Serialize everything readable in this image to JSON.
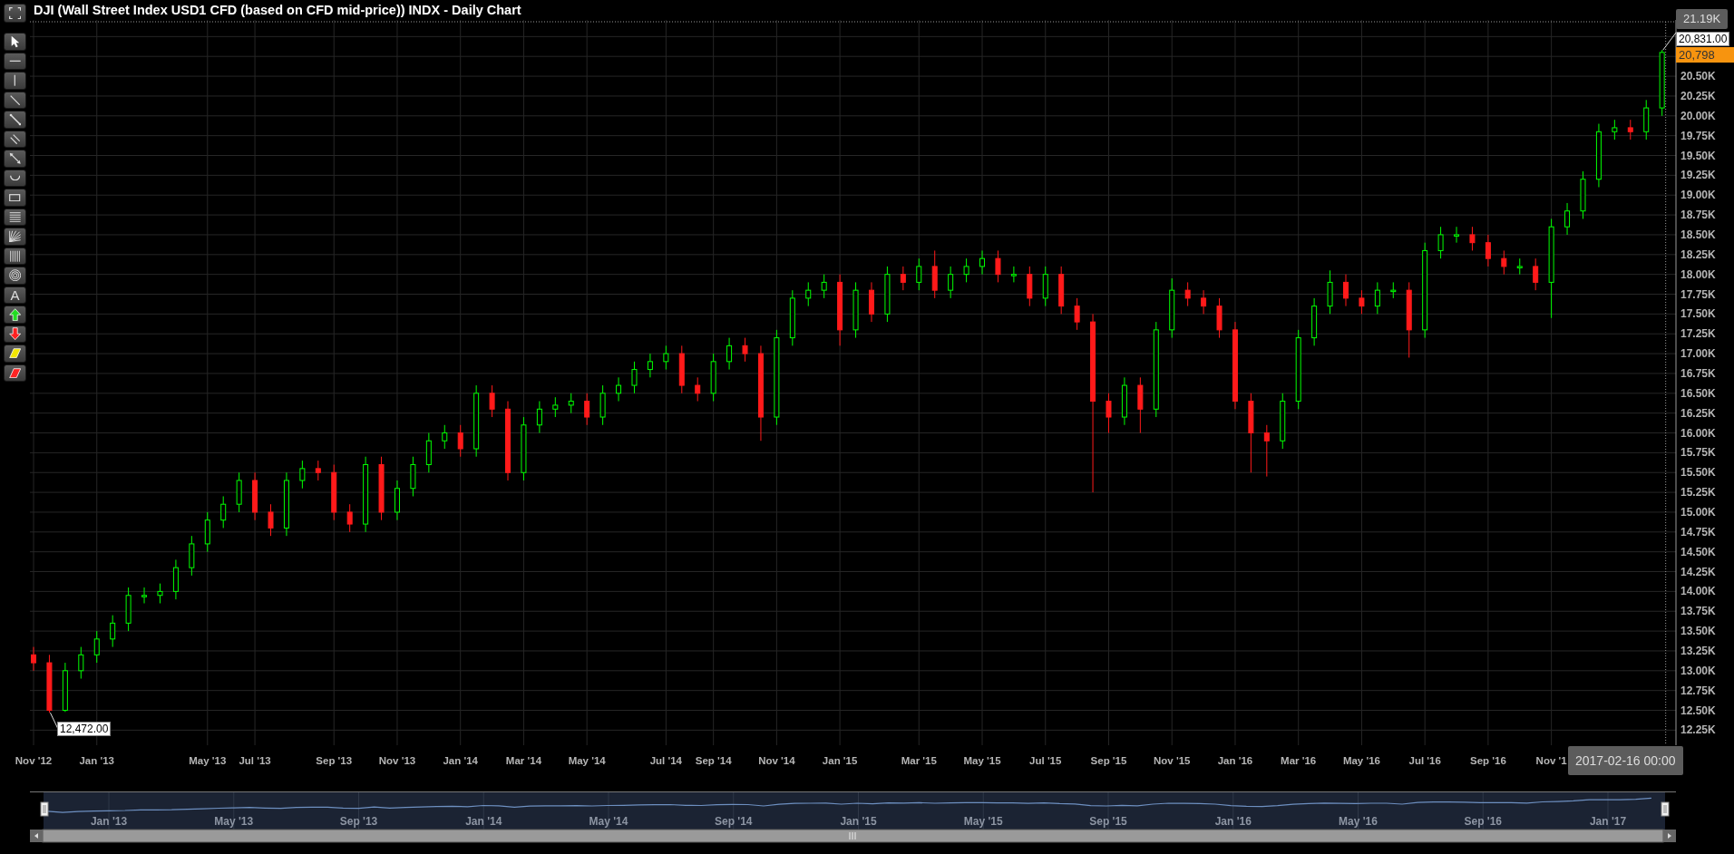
{
  "title": "DJI (Wall Street Index USD1 CFD (based on CFD mid-price)) INDX - Daily Chart",
  "toolbar": {
    "expand": {
      "kind": "expand"
    },
    "tools": [
      {
        "kind": "pointer"
      },
      {
        "kind": "hline"
      },
      {
        "kind": "vline"
      },
      {
        "kind": "trendline"
      },
      {
        "kind": "segment"
      },
      {
        "kind": "parallel"
      },
      {
        "kind": "arrowline"
      },
      {
        "kind": "arc"
      },
      {
        "kind": "rect"
      },
      {
        "kind": "levels"
      },
      {
        "kind": "fan"
      },
      {
        "kind": "cycles"
      },
      {
        "kind": "circles"
      },
      {
        "kind": "text",
        "label": "A"
      },
      {
        "kind": "up"
      },
      {
        "kind": "down"
      },
      {
        "kind": "highlighter"
      },
      {
        "kind": "eraser"
      }
    ]
  },
  "chart": {
    "chart_data": {
      "type": "candlestick",
      "categories": [
        "Nov '12",
        null,
        null,
        null,
        "Jan '13",
        null,
        null,
        null,
        null,
        null,
        null,
        "May '13",
        null,
        null,
        "Jul '13",
        null,
        null,
        null,
        null,
        "Sep '13",
        null,
        null,
        null,
        "Nov '13",
        null,
        null,
        null,
        "Jan '14",
        null,
        null,
        null,
        "Mar '14",
        null,
        null,
        null,
        "May '14",
        null,
        null,
        null,
        null,
        "Jul '14",
        null,
        null,
        "Sep '14",
        null,
        null,
        null,
        "Nov '14",
        null,
        null,
        null,
        "Jan '15",
        null,
        null,
        null,
        null,
        "Mar '15",
        null,
        null,
        null,
        "May '15",
        null,
        null,
        null,
        "Jul '15",
        null,
        null,
        null,
        "Sep '15",
        null,
        null,
        null,
        "Nov '15",
        null,
        null,
        null,
        "Jan '16",
        null,
        null,
        null,
        "Mar '16",
        null,
        null,
        null,
        "May '16",
        null,
        null,
        null,
        "Jul '16",
        null,
        null,
        null,
        "Sep '16",
        null,
        null,
        null,
        "Nov '1",
        null,
        null,
        null,
        null,
        null,
        null,
        null
      ],
      "ohlc": [
        [
          13.2,
          13.3,
          13.0,
          13.1
        ],
        [
          13.1,
          13.2,
          12.47,
          12.5
        ],
        [
          12.5,
          13.1,
          12.48,
          13.0
        ],
        [
          13.0,
          13.3,
          12.9,
          13.2
        ],
        [
          13.2,
          13.5,
          13.1,
          13.4
        ],
        [
          13.4,
          13.7,
          13.3,
          13.6
        ],
        [
          13.6,
          14.05,
          13.5,
          13.95
        ],
        [
          13.95,
          14.05,
          13.85,
          13.95
        ],
        [
          13.95,
          14.1,
          13.85,
          14.0
        ],
        [
          14.0,
          14.4,
          13.9,
          14.3
        ],
        [
          14.3,
          14.7,
          14.2,
          14.6
        ],
        [
          14.6,
          15.0,
          14.5,
          14.9
        ],
        [
          14.9,
          15.2,
          14.8,
          15.1
        ],
        [
          15.1,
          15.5,
          15.0,
          15.4
        ],
        [
          15.4,
          15.5,
          14.9,
          15.0
        ],
        [
          15.0,
          15.1,
          14.7,
          14.8
        ],
        [
          14.8,
          15.5,
          14.7,
          15.4
        ],
        [
          15.4,
          15.65,
          15.3,
          15.55
        ],
        [
          15.55,
          15.65,
          15.4,
          15.5
        ],
        [
          15.5,
          15.6,
          14.9,
          15.0
        ],
        [
          15.0,
          15.1,
          14.75,
          14.85
        ],
        [
          14.85,
          15.7,
          14.75,
          15.6
        ],
        [
          15.6,
          15.7,
          14.9,
          15.0
        ],
        [
          15.0,
          15.4,
          14.9,
          15.3
        ],
        [
          15.3,
          15.7,
          15.2,
          15.6
        ],
        [
          15.6,
          16.0,
          15.5,
          15.9
        ],
        [
          15.9,
          16.1,
          15.8,
          16.0
        ],
        [
          16.0,
          16.1,
          15.7,
          15.8
        ],
        [
          15.8,
          16.6,
          15.7,
          16.5
        ],
        [
          16.5,
          16.6,
          16.2,
          16.3
        ],
        [
          16.3,
          16.4,
          15.4,
          15.5
        ],
        [
          15.5,
          16.2,
          15.4,
          16.1
        ],
        [
          16.1,
          16.4,
          16.0,
          16.3
        ],
        [
          16.3,
          16.45,
          16.2,
          16.35
        ],
        [
          16.35,
          16.5,
          16.25,
          16.4
        ],
        [
          16.4,
          16.5,
          16.1,
          16.2
        ],
        [
          16.2,
          16.6,
          16.1,
          16.5
        ],
        [
          16.5,
          16.7,
          16.4,
          16.6
        ],
        [
          16.6,
          16.9,
          16.5,
          16.8
        ],
        [
          16.8,
          17.0,
          16.7,
          16.9
        ],
        [
          16.9,
          17.1,
          16.8,
          17.0
        ],
        [
          17.0,
          17.1,
          16.5,
          16.6
        ],
        [
          16.6,
          16.7,
          16.4,
          16.5
        ],
        [
          16.5,
          17.0,
          16.4,
          16.9
        ],
        [
          16.9,
          17.2,
          16.8,
          17.1
        ],
        [
          17.1,
          17.2,
          16.9,
          17.0
        ],
        [
          17.0,
          17.1,
          15.9,
          16.2
        ],
        [
          16.2,
          17.3,
          16.1,
          17.2
        ],
        [
          17.2,
          17.8,
          17.1,
          17.7
        ],
        [
          17.7,
          17.9,
          17.6,
          17.8
        ],
        [
          17.8,
          18.0,
          17.7,
          17.9
        ],
        [
          17.9,
          18.0,
          17.1,
          17.3
        ],
        [
          17.3,
          17.9,
          17.2,
          17.8
        ],
        [
          17.8,
          17.9,
          17.4,
          17.5
        ],
        [
          17.5,
          18.1,
          17.4,
          18.0
        ],
        [
          18.0,
          18.1,
          17.8,
          17.9
        ],
        [
          17.9,
          18.2,
          17.8,
          18.1
        ],
        [
          18.1,
          18.3,
          17.7,
          17.8
        ],
        [
          17.8,
          18.1,
          17.7,
          18.0
        ],
        [
          18.0,
          18.2,
          17.9,
          18.1
        ],
        [
          18.1,
          18.3,
          18.0,
          18.2
        ],
        [
          18.2,
          18.3,
          17.9,
          18.0
        ],
        [
          18.0,
          18.1,
          17.9,
          18.0
        ],
        [
          18.0,
          18.1,
          17.6,
          17.7
        ],
        [
          17.7,
          18.1,
          17.6,
          18.0
        ],
        [
          18.0,
          18.1,
          17.5,
          17.6
        ],
        [
          17.6,
          17.7,
          17.3,
          17.4
        ],
        [
          17.4,
          17.5,
          15.25,
          16.4
        ],
        [
          16.4,
          16.5,
          16.0,
          16.2
        ],
        [
          16.2,
          16.7,
          16.1,
          16.6
        ],
        [
          16.6,
          16.7,
          16.0,
          16.3
        ],
        [
          16.3,
          17.4,
          16.2,
          17.3
        ],
        [
          17.3,
          17.95,
          17.2,
          17.8
        ],
        [
          17.8,
          17.9,
          17.6,
          17.7
        ],
        [
          17.7,
          17.8,
          17.5,
          17.6
        ],
        [
          17.6,
          17.7,
          17.2,
          17.3
        ],
        [
          17.3,
          17.4,
          16.3,
          16.4
        ],
        [
          16.4,
          16.5,
          15.5,
          16.0
        ],
        [
          16.0,
          16.1,
          15.45,
          15.9
        ],
        [
          15.9,
          16.5,
          15.8,
          16.4
        ],
        [
          16.4,
          17.3,
          16.3,
          17.2
        ],
        [
          17.2,
          17.7,
          17.1,
          17.6
        ],
        [
          17.6,
          18.05,
          17.5,
          17.9
        ],
        [
          17.9,
          18.0,
          17.6,
          17.7
        ],
        [
          17.7,
          17.8,
          17.5,
          17.6
        ],
        [
          17.6,
          17.9,
          17.5,
          17.8
        ],
        [
          17.8,
          17.9,
          17.7,
          17.8
        ],
        [
          17.8,
          17.9,
          16.95,
          17.3
        ],
        [
          17.3,
          18.4,
          17.2,
          18.3
        ],
        [
          18.3,
          18.6,
          18.2,
          18.5
        ],
        [
          18.5,
          18.6,
          18.4,
          18.5
        ],
        [
          18.5,
          18.6,
          18.3,
          18.4
        ],
        [
          18.4,
          18.5,
          18.1,
          18.2
        ],
        [
          18.2,
          18.3,
          18.0,
          18.1
        ],
        [
          18.1,
          18.2,
          18.0,
          18.1
        ],
        [
          18.1,
          18.2,
          17.8,
          17.9
        ],
        [
          17.9,
          18.7,
          17.45,
          18.6
        ],
        [
          18.6,
          18.9,
          18.5,
          18.8
        ],
        [
          18.8,
          19.3,
          18.7,
          19.2
        ],
        [
          19.2,
          19.9,
          19.1,
          19.8
        ],
        [
          19.8,
          19.95,
          19.7,
          19.85
        ],
        [
          19.85,
          19.95,
          19.7,
          19.8
        ],
        [
          19.8,
          20.2,
          19.7,
          20.1
        ],
        [
          20.1,
          20.83,
          20.0,
          20.8
        ]
      ],
      "ylim": [
        12.06,
        21.21
      ],
      "grid": true,
      "yticks": [
        {
          "value": 12.25,
          "label": "12.25K"
        },
        {
          "value": 12.5,
          "label": "12.50K"
        },
        {
          "value": 12.75,
          "label": "12.75K"
        },
        {
          "value": 13.0,
          "label": "13.00K"
        },
        {
          "value": 13.25,
          "label": "13.25K"
        },
        {
          "value": 13.5,
          "label": "13.50K"
        },
        {
          "value": 13.75,
          "label": "13.75K"
        },
        {
          "value": 14.0,
          "label": "14.00K"
        },
        {
          "value": 14.25,
          "label": "14.25K"
        },
        {
          "value": 14.5,
          "label": "14.50K"
        },
        {
          "value": 14.75,
          "label": "14.75K"
        },
        {
          "value": 15.0,
          "label": "15.00K"
        },
        {
          "value": 15.25,
          "label": "15.25K"
        },
        {
          "value": 15.5,
          "label": "15.50K"
        },
        {
          "value": 15.75,
          "label": "15.75K"
        },
        {
          "value": 16.0,
          "label": "16.00K"
        },
        {
          "value": 16.25,
          "label": "16.25K"
        },
        {
          "value": 16.5,
          "label": "16.50K"
        },
        {
          "value": 16.75,
          "label": "16.75K"
        },
        {
          "value": 17.0,
          "label": "17.00K"
        },
        {
          "value": 17.25,
          "label": "17.25K"
        },
        {
          "value": 17.5,
          "label": "17.50K"
        },
        {
          "value": 17.75,
          "label": "17.75K"
        },
        {
          "value": 18.0,
          "label": "18.00K"
        },
        {
          "value": 18.25,
          "label": "18.25K"
        },
        {
          "value": 18.5,
          "label": "18.50K"
        },
        {
          "value": 18.75,
          "label": "18.75K"
        },
        {
          "value": 19.0,
          "label": "19.00K"
        },
        {
          "value": 19.25,
          "label": "19.25K"
        },
        {
          "value": 19.5,
          "label": "19.50K"
        },
        {
          "value": 19.75,
          "label": "19.75K"
        },
        {
          "value": 20.0,
          "label": "20.00K"
        },
        {
          "value": 20.25,
          "label": "20.25K"
        },
        {
          "value": 20.5,
          "label": "20.50K"
        }
      ]
    },
    "crosshair_price": "21.19K",
    "crosshair_date": "2017-02-16 00:00",
    "high_label": "20,831.00",
    "last_price": "20,798",
    "low_label": "12,472.00"
  },
  "navigator": {
    "labels": [
      "Jan '13",
      "May '13",
      "Sep '13",
      "Jan '14",
      "May '14",
      "Sep '14",
      "Jan '15",
      "May '15",
      "Sep '15",
      "Jan '16",
      "May '16",
      "Sep '16",
      "Jan '17"
    ]
  }
}
